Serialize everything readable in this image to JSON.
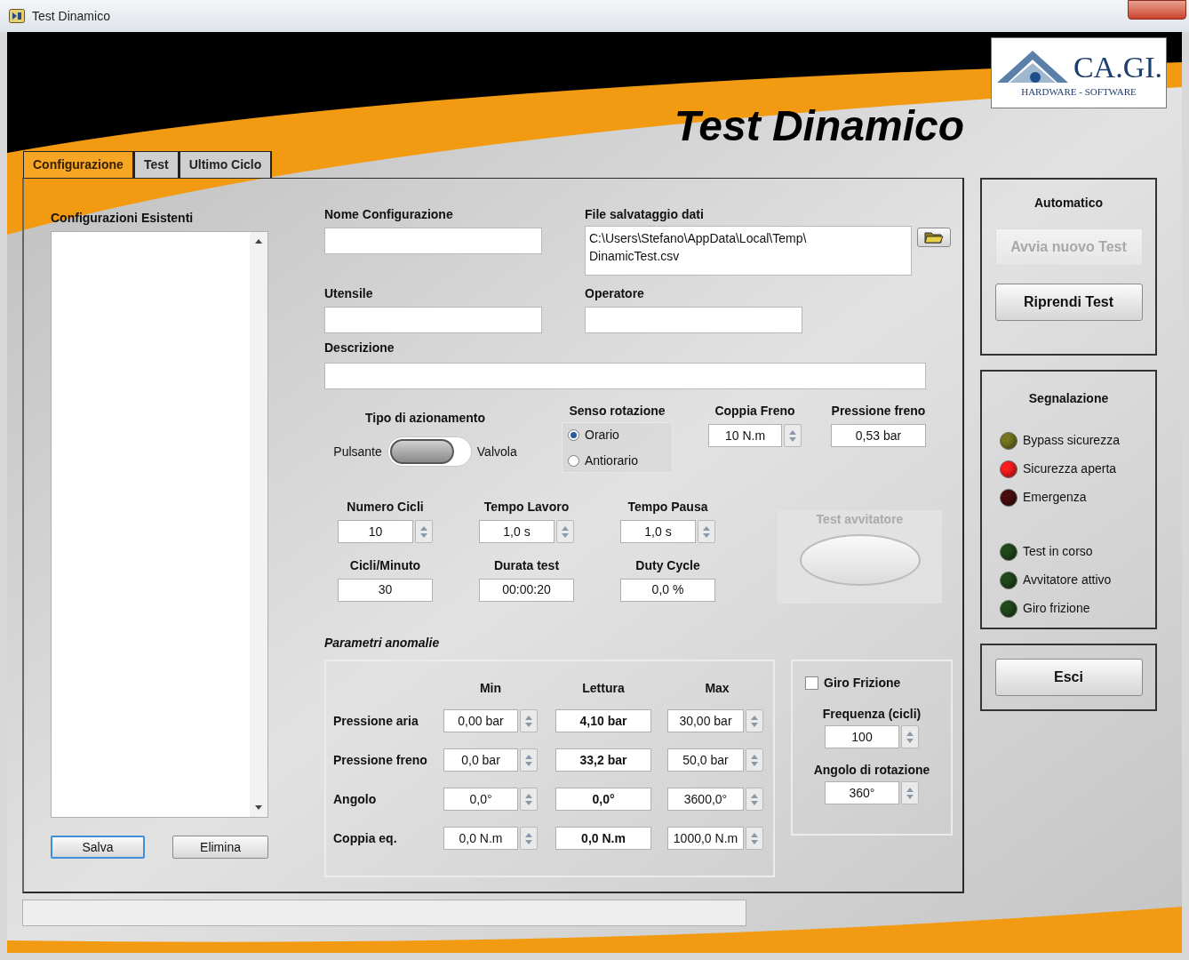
{
  "window": {
    "title": "Test Dinamico"
  },
  "header": {
    "title": "Test Dinamico",
    "logo": {
      "name": "CA.GI.",
      "tagline": "HARDWARE - SOFTWARE"
    }
  },
  "tabs": [
    {
      "label": "Configurazione",
      "selected": true
    },
    {
      "label": "Test",
      "selected": false
    },
    {
      "label": "Ultimo Ciclo",
      "selected": false
    }
  ],
  "configurations": {
    "label": "Configurazioni Esistenti",
    "buttons": [
      {
        "label": "Salva",
        "focused": true
      },
      {
        "label": "Elimina",
        "focused": false
      }
    ]
  },
  "name_field": {
    "label": "Nome Configurazione"
  },
  "file_field": {
    "label": "File salvataggio dati",
    "value_lines": [
      "C:\\Users\\Stefano\\AppData\\Local\\Temp\\",
      "DinamicTest.csv"
    ]
  },
  "tool_field": {
    "label": "Utensile"
  },
  "operator_field": {
    "label": "Operatore"
  },
  "description_field": {
    "label": "Descrizione"
  },
  "actuation": {
    "label": "Tipo di azionamento",
    "off_label": "Pulsante",
    "on_label": "Valvola",
    "on": false
  },
  "rotation": {
    "label": "Senso rotazione",
    "options": [
      {
        "label": "Orario",
        "selected": true
      },
      {
        "label": "Antiorario",
        "selected": false
      }
    ]
  },
  "brake": [
    {
      "label": "Coppia Freno",
      "value": "10 N.m",
      "kind": "control"
    },
    {
      "label": "Pressione freno",
      "value": "0,53 bar",
      "kind": "indicator"
    }
  ],
  "cycle_params": [
    {
      "label": "Numero Cicli",
      "value": "10",
      "kind": "control"
    },
    {
      "label": "Tempo Lavoro",
      "value": "1,0 s",
      "kind": "control"
    },
    {
      "label": "Tempo Pausa",
      "value": "1,0 s",
      "kind": "control"
    },
    {
      "label": "Cicli/Minuto",
      "value": "30",
      "kind": "indicator"
    },
    {
      "label": "Durata test",
      "value": "00:00:20",
      "kind": "indicator"
    },
    {
      "label": "Duty Cycle",
      "value": "0,0 %",
      "kind": "indicator"
    }
  ],
  "screwdriver_test": {
    "label": "Test avvitatore",
    "disabled": true
  },
  "anomalies": {
    "title": "Parametri anomalie",
    "columns": [
      "Min",
      "Lettura",
      "Max"
    ],
    "rows": [
      {
        "label": "Pressione aria",
        "min": "0,00 bar",
        "reading": "4,10 bar",
        "max": "30,00 bar"
      },
      {
        "label": "Pressione freno",
        "min": "0,0 bar",
        "reading": "33,2 bar",
        "max": "50,0 bar"
      },
      {
        "label": "Angolo",
        "min": "0,0°",
        "reading": "0,0°",
        "max": "3600,0°"
      },
      {
        "label": "Coppia eq.",
        "min": "0,0 N.m",
        "reading": "0,0 N.m",
        "max": "1000,0 N.m"
      }
    ]
  },
  "clutch": {
    "label": "Giro Frizione",
    "checked": false,
    "fields": [
      {
        "label": "Frequenza (cicli)",
        "value": "100"
      },
      {
        "label": "Angolo di rotazione",
        "value": "360°"
      }
    ]
  },
  "automatic": {
    "title": "Automatico",
    "buttons": [
      {
        "label": "Avvia nuovo Test",
        "disabled": true
      },
      {
        "label": "Riprendi Test",
        "disabled": false
      }
    ]
  },
  "signals": {
    "title": "Segnalazione",
    "groups": [
      {
        "lights": [
          {
            "label": "Bypass sicurezza",
            "color": "#77771f"
          },
          {
            "label": "Sicurezza aperta",
            "color": "#ff1c1c"
          },
          {
            "label": "Emergenza",
            "color": "#4a0e0e"
          }
        ]
      },
      {
        "lights": [
          {
            "label": "Test in corso",
            "color": "#1f4a1a"
          },
          {
            "label": "Avvitatore attivo",
            "color": "#1f4a1a"
          },
          {
            "label": "Giro frizione",
            "color": "#1f4a1a"
          }
        ]
      }
    ]
  },
  "exit": {
    "label": "Esci"
  }
}
